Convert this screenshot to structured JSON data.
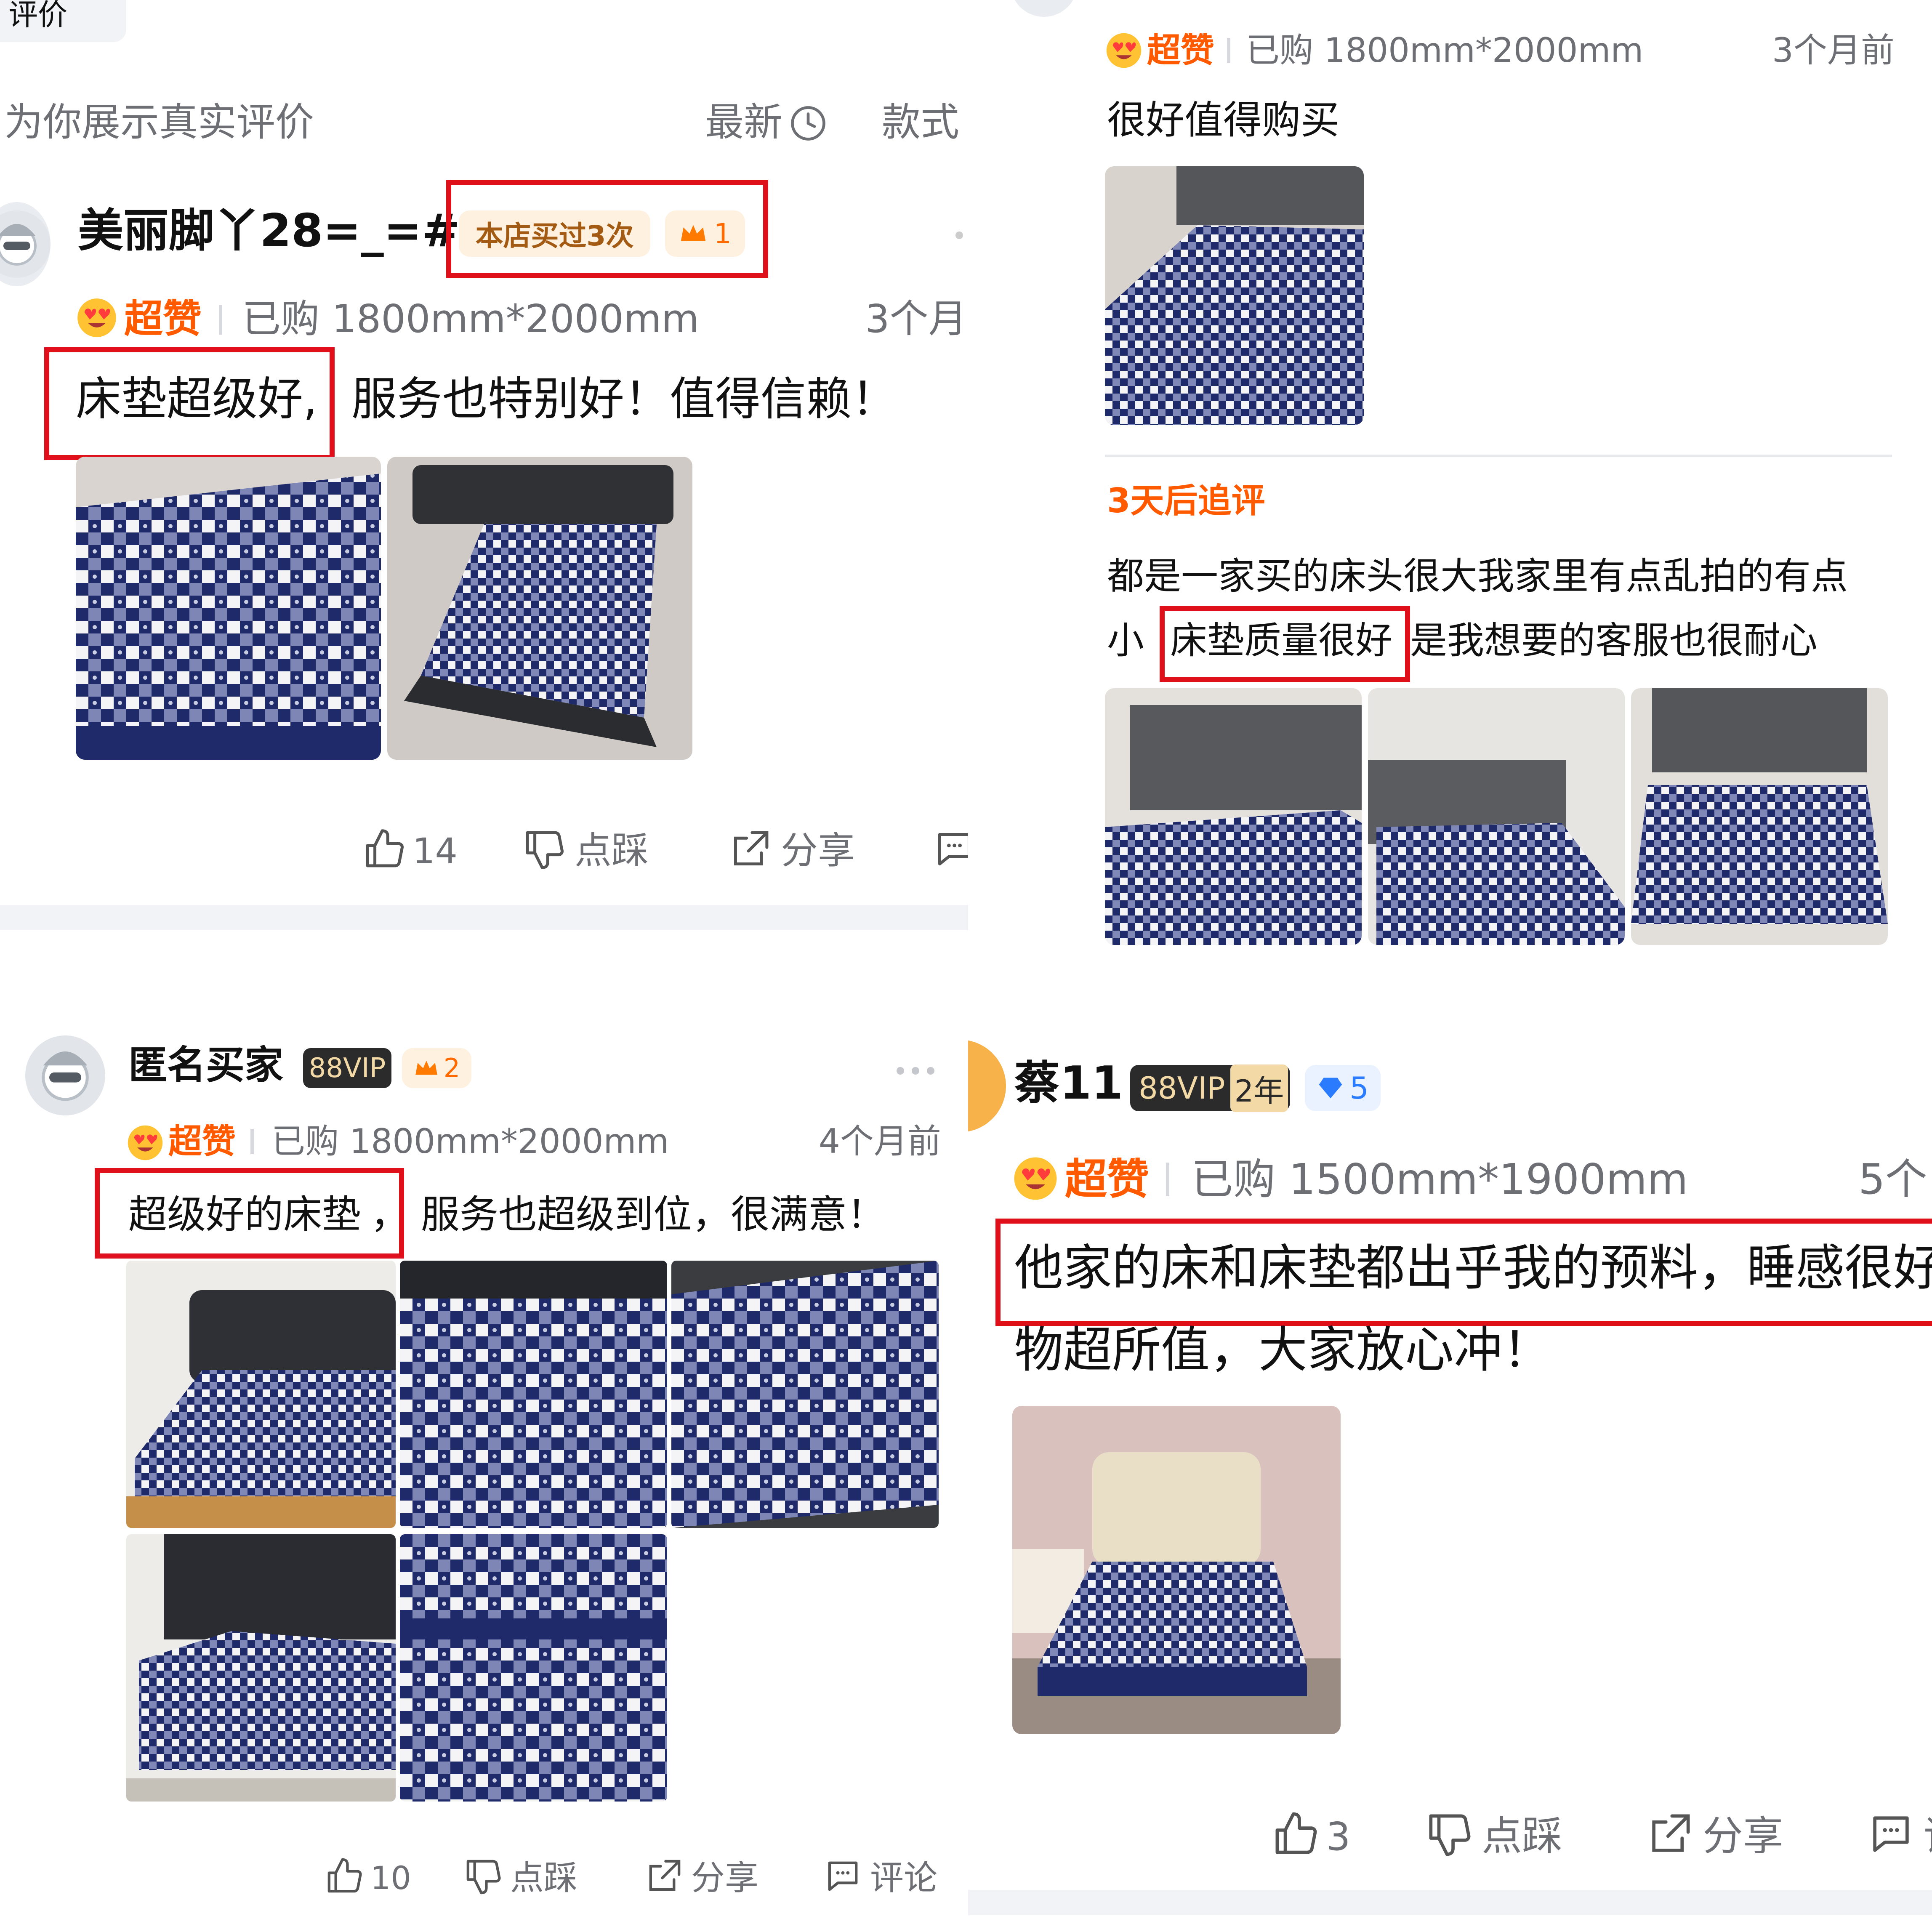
{
  "panel1": {
    "tab_label": "评价",
    "subtitle": "为你展示真实评价",
    "sort_label": "最新",
    "filter_label": "款式",
    "username": "美丽脚丫28=_=#",
    "store_badge": "本店买过3次",
    "crown_level": "1",
    "rating": "超赞",
    "purchased": "已购 1800mm*2000mm",
    "time": "3个月",
    "review_highlight": "床垫超级好,",
    "review_rest": "服务也特别好！值得信赖！",
    "like_count": "14",
    "dislike_label": "点踩",
    "share_label": "分享"
  },
  "panel2": {
    "rating": "超赞",
    "purchased": "已购 1800mm*2000mm",
    "time": "3个月前",
    "review": "很好值得购买",
    "followup_title": "3天后追评",
    "followup_line1": "都是一家买的床头很大我家里有点乱拍的有点",
    "followup_prefix": "小",
    "followup_highlight": "床垫质量很好",
    "followup_rest": "是我想要的客服也很耐心"
  },
  "panel3": {
    "username": "匿名买家",
    "vip_badge": "88VIP",
    "crown_level": "2",
    "rating": "超赞",
    "purchased": "已购 1800mm*2000mm",
    "time": "4个月前",
    "review_highlight": "超级好的床垫",
    "review_comma": "，",
    "review_rest": "服务也超级到位，很满意！",
    "like_count": "10",
    "dislike_label": "点踩",
    "share_label": "分享",
    "comment_label": "评论"
  },
  "panel4": {
    "username": "蔡11",
    "vip_badge": "88VIP",
    "vip_years": "2年",
    "diamond_level": "5",
    "rating": "超赞",
    "purchased": "已购 1500mm*1900mm",
    "time": "5个",
    "review_highlight": "他家的床和床垫都出乎我的预料，睡感很好",
    "review_line2": "物超所值，大家放心冲！",
    "like_count": "3",
    "dislike_label": "点踩",
    "share_label": "分享",
    "comment_label": "评"
  },
  "icons": [
    "clock-icon",
    "crown-icon",
    "heart-eyes-icon",
    "thumbs-up-icon",
    "thumbs-down-icon",
    "share-icon",
    "comment-icon",
    "diamond-icon",
    "more-dots-icon"
  ],
  "colors": {
    "highlight_red": "#e0101a",
    "rating_orange": "#ff5a00",
    "badge_bg": "#fff1e0",
    "badge_text": "#a35a12",
    "vip_bg": "#2b2b2b",
    "vip_text": "#f2d9a6",
    "mattress_navy": "#1f2a6b"
  }
}
